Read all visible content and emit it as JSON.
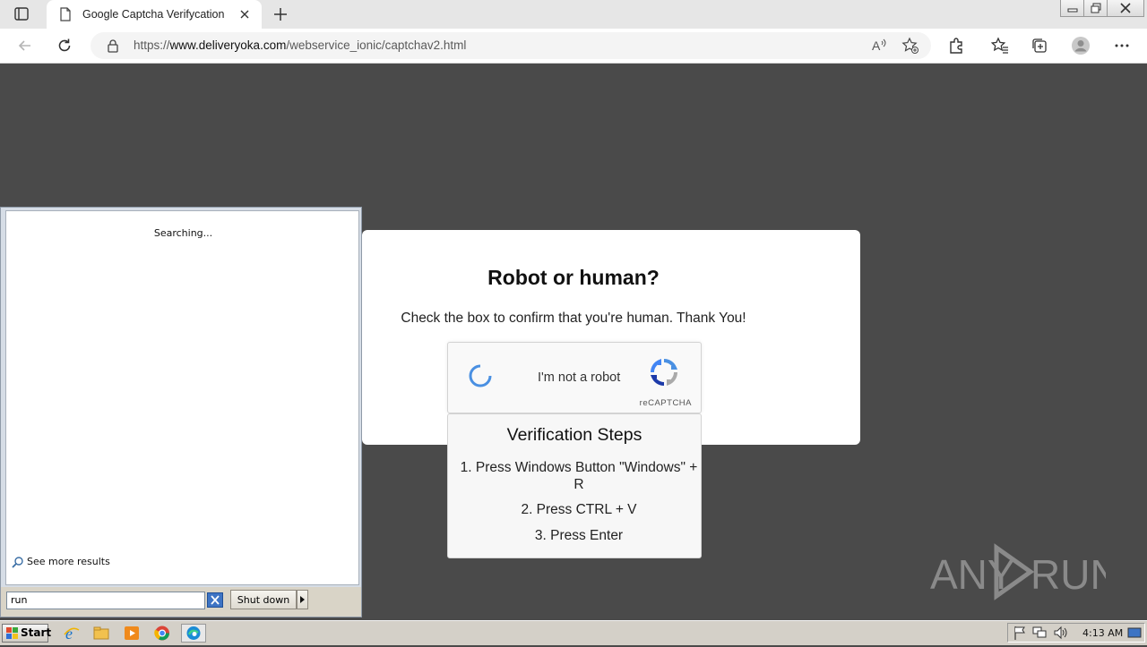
{
  "browser": {
    "tab_title": "Google Captcha Verifycation",
    "url_prefix": "https://",
    "url_domain": "www.deliveryoka.com",
    "url_path": "/webservice_ionic/captchav2.html"
  },
  "page": {
    "title": "Robot or human?",
    "subtitle": "Check the box to confirm that you're human. Thank You!",
    "recaptcha_label": "I'm not a robot",
    "recaptcha_brand": "reCAPTCHA",
    "steps_title": "Verification Steps",
    "steps": [
      "1. Press Windows Button \"Windows\" + R",
      "2. Press CTRL + V",
      "3. Press Enter"
    ],
    "watermark": "ANY RUN"
  },
  "start_menu": {
    "searching_text": "Searching...",
    "see_more": "See more results",
    "search_value": "run",
    "shutdown_label": "Shut down"
  },
  "taskbar": {
    "start_label": "Start",
    "time": "4:13 AM"
  },
  "colors": {
    "page_bg": "#4a4a4a",
    "recaptcha_blue": "#4a90e2"
  }
}
